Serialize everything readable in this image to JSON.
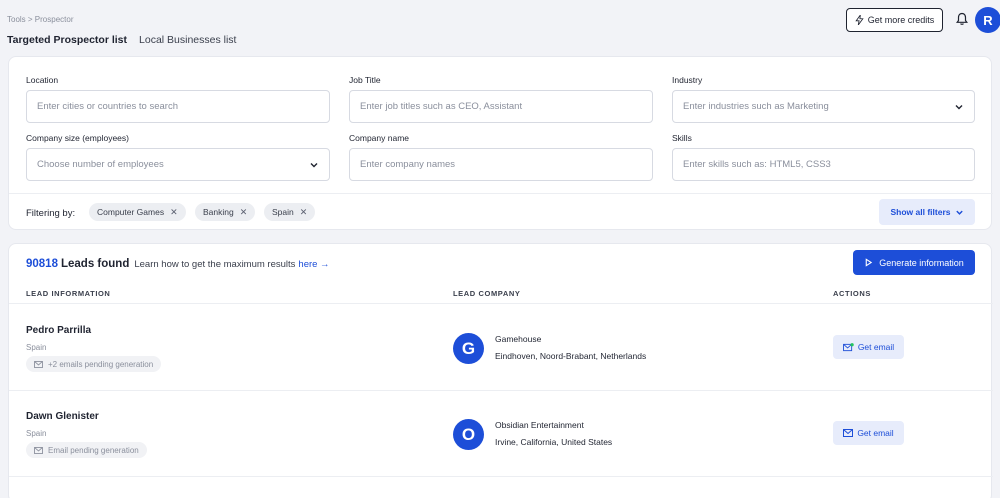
{
  "header": {
    "breadcrumb": "Tools > Prospector",
    "tab_active": "Targeted Prospector list",
    "tab_other": "Local Businesses list",
    "credits_label": "Get more credits",
    "avatar_letter": "R"
  },
  "filters": {
    "location_label": "Location",
    "location_placeholder": "Enter cities or countries to search",
    "job_label": "Job Title",
    "job_placeholder": "Enter job titles such as CEO, Assistant",
    "industry_label": "Industry",
    "industry_placeholder": "Enter industries such as Marketing",
    "size_label": "Company size (employees)",
    "size_placeholder": "Choose number of employees",
    "company_label": "Company name",
    "company_placeholder": "Enter company names",
    "skills_label": "Skills",
    "skills_placeholder": "Enter skills such as: HTML5, CSS3",
    "filtering_by": "Filtering by:",
    "chips": [
      "Computer Games",
      "Banking",
      "Spain"
    ],
    "show_all": "Show all filters"
  },
  "results": {
    "count": "90818",
    "found": "Leads found",
    "help_text": "Learn how to get the maximum results",
    "help_link": "here →",
    "generate_label": "Generate information",
    "col_lead": "LEAD INFORMATION",
    "col_company": "LEAD COMPANY",
    "col_actions": "ACTIONS",
    "rows": [
      {
        "name": "Pedro Parrilla",
        "country": "Spain",
        "pending": "+2 emails pending generation",
        "logo": "G",
        "company": "Gamehouse",
        "location": "Eindhoven, Noord-Brabant, Netherlands",
        "action": "Get email"
      },
      {
        "name": "Dawn Glenister",
        "country": "Spain",
        "pending": "Email pending generation",
        "logo": "O",
        "company": "Obsidian Entertainment",
        "location": "Irvine, California, United States",
        "action": "Get email"
      }
    ]
  }
}
